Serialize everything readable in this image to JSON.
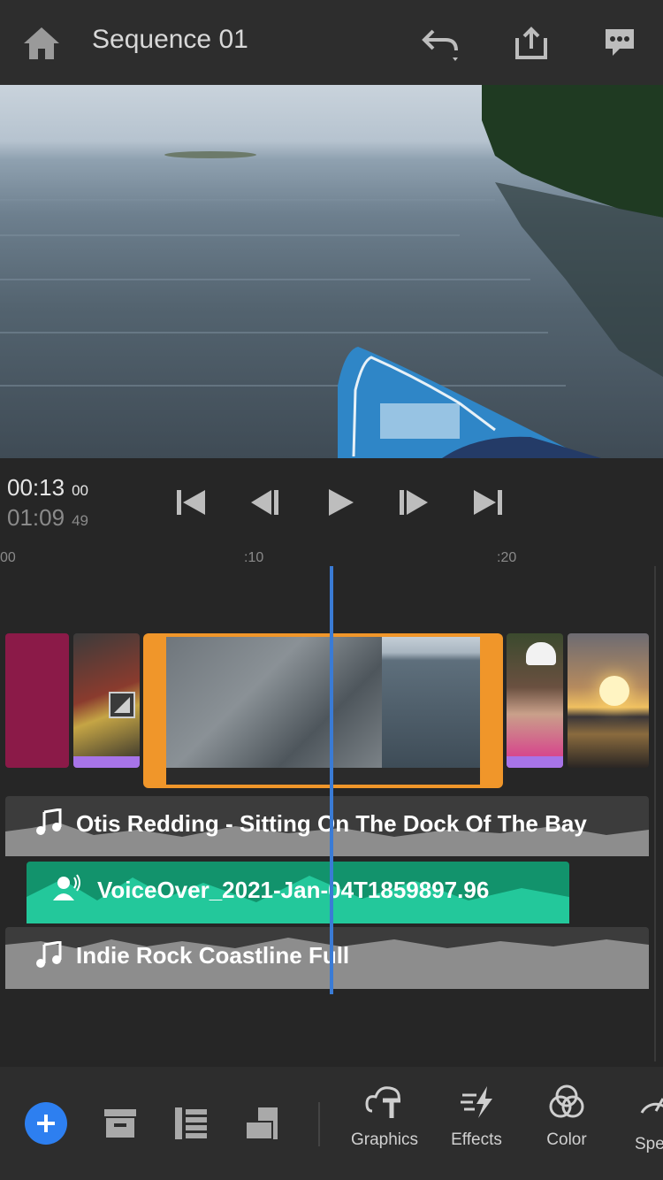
{
  "header": {
    "title": "Sequence 01",
    "icons": [
      "home-icon",
      "undo-icon",
      "share-icon",
      "comment-icon"
    ]
  },
  "transport": {
    "current_time": "00:13",
    "current_frames": "00",
    "total_time": "01:09",
    "total_frames": "49"
  },
  "ruler": {
    "marks": [
      "00",
      ":10",
      ":20"
    ]
  },
  "tracks": {
    "audio1": "Otis Redding - Sitting On The Dock Of The Bay",
    "voiceover": "VoiceOver_2021-Jan-04T1859897.96",
    "audio2": "Indie Rock Coastline Full"
  },
  "toolbar": {
    "graphics": "Graphics",
    "effects": "Effects",
    "color": "Color",
    "speed": "Spe"
  },
  "colors": {
    "accent_orange": "#f0962a",
    "playhead": "#3a7bd5",
    "voiceover_green": "#12936c",
    "add_button": "#2d7ff0"
  }
}
